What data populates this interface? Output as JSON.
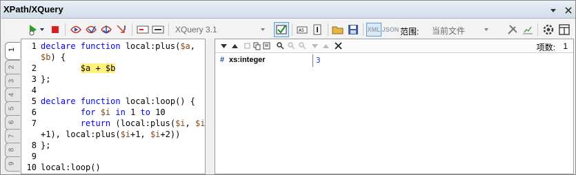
{
  "window": {
    "title": "XPath/XQuery"
  },
  "toolbar": {
    "language_combo": "XQuery 3.1",
    "scope_label": "范围:",
    "scope_combo": "当前文件",
    "xml_badge": "XML",
    "json_badge": "JSON"
  },
  "tabs": [
    "1",
    "2",
    "3",
    "4",
    "5",
    "6",
    "7",
    "8",
    "9"
  ],
  "editor": {
    "lines": [
      {
        "num": "1",
        "parts": [
          {
            "t": "declare function ",
            "c": "kw"
          },
          {
            "t": "local:plus(",
            "c": ""
          },
          {
            "t": "$a",
            "c": "var"
          },
          {
            "t": ",",
            "c": ""
          }
        ]
      },
      {
        "num": "",
        "parts": [
          {
            "t": "$b",
            "c": "var"
          },
          {
            "t": ") {",
            "c": ""
          }
        ]
      },
      {
        "num": "2",
        "parts": [
          {
            "t": "        ",
            "c": ""
          },
          {
            "t": "$a + $b",
            "c": "hl"
          }
        ]
      },
      {
        "num": "3",
        "parts": [
          {
            "t": "};",
            "c": ""
          }
        ]
      },
      {
        "num": "4",
        "parts": [
          {
            "t": "",
            "c": ""
          }
        ]
      },
      {
        "num": "5",
        "parts": [
          {
            "t": "declare function ",
            "c": "kw"
          },
          {
            "t": "local:loop() {",
            "c": ""
          }
        ]
      },
      {
        "num": "6",
        "parts": [
          {
            "t": "        ",
            "c": ""
          },
          {
            "t": "for ",
            "c": "kw"
          },
          {
            "t": "$i",
            "c": "var"
          },
          {
            "t": " in ",
            "c": "kw"
          },
          {
            "t": "1 ",
            "c": ""
          },
          {
            "t": "to ",
            "c": "kw"
          },
          {
            "t": "10",
            "c": ""
          }
        ]
      },
      {
        "num": "7",
        "parts": [
          {
            "t": "        ",
            "c": ""
          },
          {
            "t": "return ",
            "c": "kw"
          },
          {
            "t": "(local:plus(",
            "c": ""
          },
          {
            "t": "$i",
            "c": "var"
          },
          {
            "t": ", ",
            "c": ""
          },
          {
            "t": "$i",
            "c": "var"
          }
        ]
      },
      {
        "num": "",
        "parts": [
          {
            "t": "+1), local:plus(",
            "c": ""
          },
          {
            "t": "$i",
            "c": "var"
          },
          {
            "t": "+1, ",
            "c": ""
          },
          {
            "t": "$i",
            "c": "var"
          },
          {
            "t": "+2))",
            "c": ""
          }
        ]
      },
      {
        "num": "8",
        "parts": [
          {
            "t": "};",
            "c": ""
          }
        ]
      },
      {
        "num": "9",
        "parts": [
          {
            "t": "",
            "c": ""
          }
        ]
      },
      {
        "num": "10",
        "parts": [
          {
            "t": "local:loop()",
            "c": ""
          }
        ]
      }
    ]
  },
  "results": {
    "count_label": "项数:",
    "count_value": "1",
    "rows": [
      {
        "hash": "#",
        "type": "xs:integer",
        "value": "3"
      }
    ]
  },
  "colors": {
    "keyword": "#0000ff",
    "variable": "#8b4513",
    "highlight": "#fff27a",
    "accent": "#5b9bd5"
  }
}
